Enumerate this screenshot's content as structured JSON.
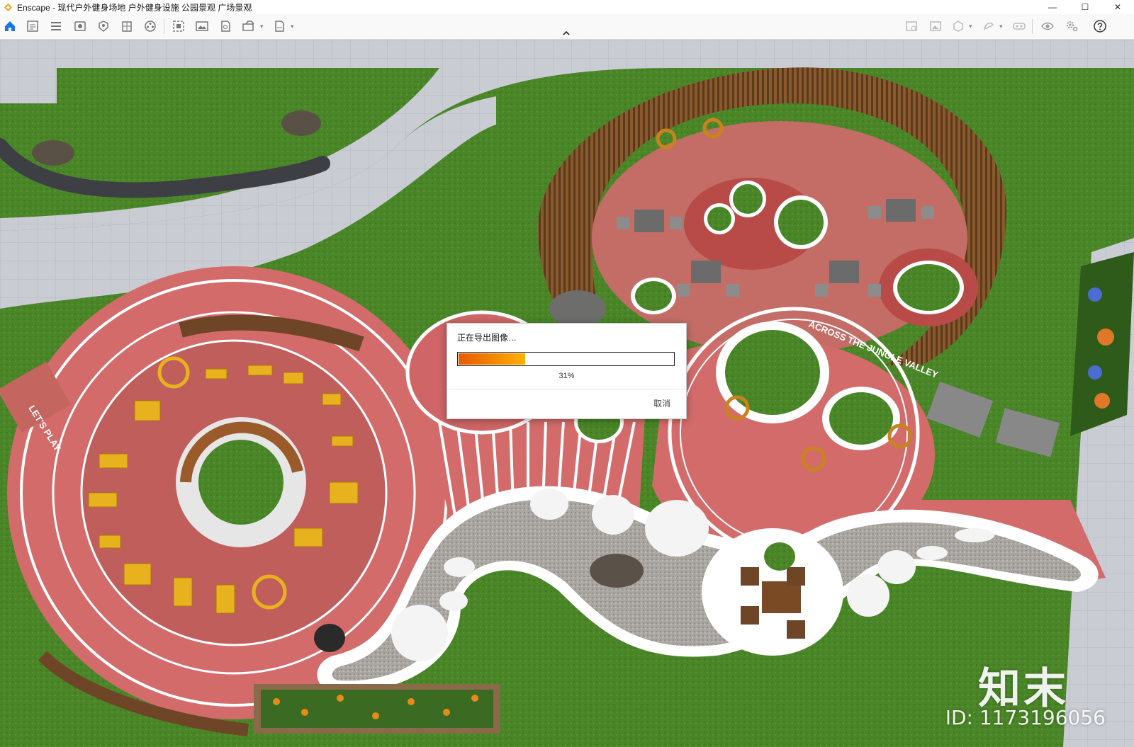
{
  "window": {
    "title": "Enscape - 现代户外健身场地 户外健身设施 公园景观 广场景观",
    "minimize_glyph": "—",
    "maximize_glyph": "☐",
    "close_glyph": "✕"
  },
  "toolbar": {
    "left_icons": [
      "home-icon",
      "asset-library-icon",
      "views-icon",
      "visual-settings-icon",
      "atmosphere-icon",
      "building-icon",
      "video-editor-icon",
      "batch-render-icon",
      "screenshot-icon",
      "panorama-icon",
      "export-icon",
      "export-format-icon"
    ],
    "right_icons": [
      "image-settings-icon",
      "frame-icon",
      "material-icon",
      "feedback-icon",
      "vr-icon",
      "eye-icon",
      "settings-icon",
      "help-icon"
    ]
  },
  "export_dialog": {
    "title": "正在导出图像…",
    "progress": 0.31,
    "progress_text": "31%",
    "cancel_label": "取消"
  },
  "render": {
    "track_label_left": "LET'S PLAY",
    "track_label_right": "ACROSS THE JUNGLE VALLEY"
  },
  "watermark": {
    "logo": "知末",
    "id": "ID: 1173196056"
  },
  "colors": {
    "accent": "#1a73e8",
    "progress_start": "#e85a00",
    "progress_end": "#ffb000",
    "track": "#c9625f",
    "grass": "#4f8a2a"
  }
}
